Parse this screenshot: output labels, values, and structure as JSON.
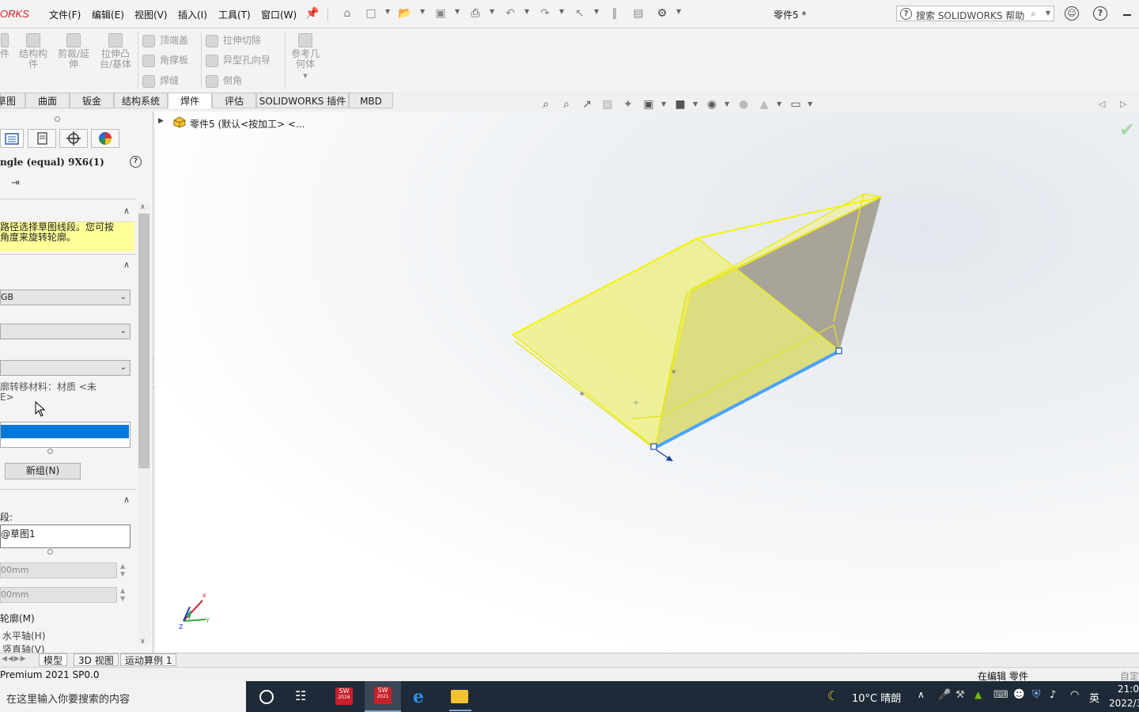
{
  "app": {
    "logo_text": "ORKS",
    "document_title": "零件5 *"
  },
  "menu": [
    {
      "id": "file",
      "label": "文件(F)"
    },
    {
      "id": "edit",
      "label": "编辑(E)"
    },
    {
      "id": "view",
      "label": "视图(V)"
    },
    {
      "id": "insert",
      "label": "插入(I)"
    },
    {
      "id": "tools",
      "label": "工具(T)"
    },
    {
      "id": "window",
      "label": "窗口(W)"
    }
  ],
  "search": {
    "placeholder": "搜索 SOLIDWORKS 帮助"
  },
  "ribbon": {
    "partial_first": "件",
    "structural_member": "结构构件",
    "trim_extend": "剪裁/延伸",
    "extruded_boss": "拉伸凸台/基体",
    "end_cap": "顶端盖",
    "gusset": "角撑板",
    "weld_bead": "焊缝",
    "extruded_cut": "拉伸切除",
    "hole_wizard": "异型孔向导",
    "chamfer": "倒角",
    "ref_geometry": "参考几何体"
  },
  "tabs": [
    {
      "id": "sketch",
      "label": "草图"
    },
    {
      "id": "surface",
      "label": "曲面"
    },
    {
      "id": "sheetmetal",
      "label": "钣金"
    },
    {
      "id": "structure",
      "label": "结构系统"
    },
    {
      "id": "weldments",
      "label": "焊件",
      "active": true
    },
    {
      "id": "evaluate",
      "label": "评估"
    },
    {
      "id": "addins",
      "label": "SOLIDWORKS 插件"
    },
    {
      "id": "mbd",
      "label": "MBD"
    }
  ],
  "panel": {
    "feature_name": "ngle (equal) 9X6(1)",
    "message_line1": "路径选择草图线段。您可按",
    "message_line2": "角度来旋转轮廓。",
    "standard_value": "GB",
    "transfer_material_line1": "廓转移材料：材质 <未",
    "transfer_material_line2": "E>",
    "new_group_label": "新组(N)",
    "segments_label": "段:",
    "segment_item": "@草图1",
    "gap1_value": "00mm",
    "gap2_value": "00mm",
    "mirror_profile_label": "轮廓(M)",
    "horizontal_axis_label": "水平轴(H)",
    "vertical_axis_label": "竖直轴(V)"
  },
  "tree": {
    "root_label": "零件5  (默认<按加工> <..."
  },
  "bottom_tabs": [
    {
      "id": "model",
      "label": "模型",
      "active": true
    },
    {
      "id": "3dview",
      "label": "3D 视图"
    },
    {
      "id": "motion",
      "label": "运动算例 1"
    }
  ],
  "status": {
    "version": "Premium 2021 SP0.0",
    "editing": "在编辑 零件",
    "custom": "自定"
  },
  "taskbar": {
    "search_placeholder": "在这里输入你要搜索的内容",
    "apps": [
      {
        "id": "sw2016",
        "label": "2016"
      },
      {
        "id": "sw2021",
        "label": "2021"
      }
    ],
    "weather": "10°C  晴朗",
    "ime": "英",
    "time": "21:0",
    "date": "2022/3"
  },
  "colors": {
    "accent_blue": "#0078d7",
    "selection_yellow": "#ffff33",
    "edge_blue": "#4aa3ff",
    "brand_red": "#d21f26"
  }
}
